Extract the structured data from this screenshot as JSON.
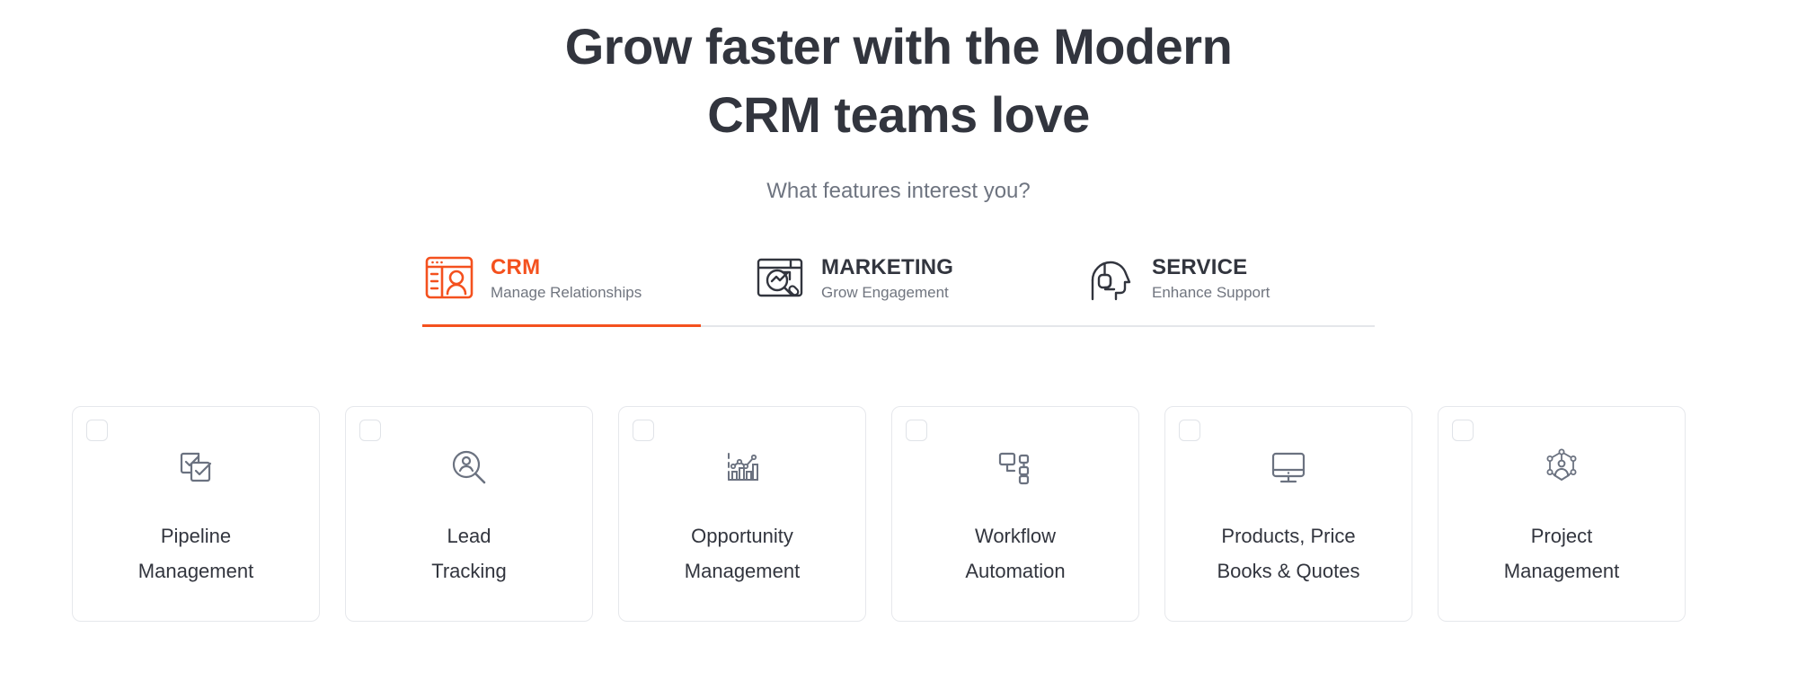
{
  "hero": {
    "title_line1": "Grow faster with the Modern",
    "title_line2": "CRM teams love",
    "subtitle": "What features interest you?"
  },
  "colors": {
    "accent": "#F4511E",
    "heading": "#32353E",
    "muted": "#6E7480",
    "icon_stroke": "#6B7280",
    "card_border": "#E6E8EC",
    "rail": "#E4E6EA"
  },
  "tabs": [
    {
      "id": "crm",
      "label": "CRM",
      "description": "Manage Relationships",
      "icon": "crm-window-person-icon",
      "active": true
    },
    {
      "id": "marketing",
      "label": "MARKETING",
      "description": "Grow Engagement",
      "icon": "marketing-trend-magnifier-icon",
      "active": false
    },
    {
      "id": "service",
      "label": "SERVICE",
      "description": "Enhance Support",
      "icon": "service-headset-head-icon",
      "active": false
    }
  ],
  "features": [
    {
      "id": "pipeline-management",
      "label": "Pipeline\nManagement",
      "icon": "checked-boxes-icon",
      "checked": false
    },
    {
      "id": "lead-tracking",
      "label": "Lead\nTracking",
      "icon": "person-magnifier-icon",
      "checked": false
    },
    {
      "id": "opportunity-management",
      "label": "Opportunity\nManagement",
      "icon": "bar-line-chart-icon",
      "checked": false
    },
    {
      "id": "workflow-automation",
      "label": "Workflow\nAutomation",
      "icon": "node-tree-icon",
      "checked": false
    },
    {
      "id": "products-price-books-quotes",
      "label": "Products, Price\nBooks & Quotes",
      "icon": "desktop-monitor-icon",
      "checked": false
    },
    {
      "id": "project-management",
      "label": "Project\nManagement",
      "icon": "team-network-icon",
      "checked": false
    }
  ]
}
